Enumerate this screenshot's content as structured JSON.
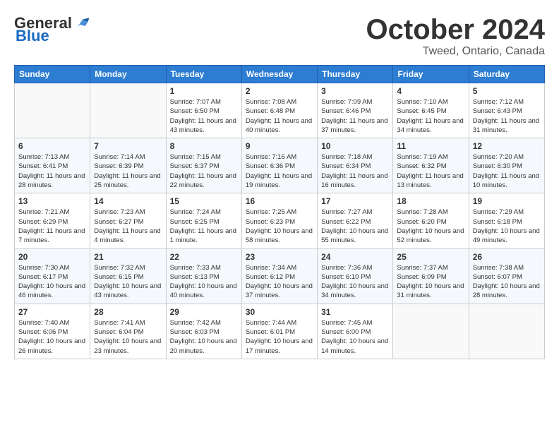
{
  "logo": {
    "general": "General",
    "blue": "Blue"
  },
  "title": "October 2024",
  "subtitle": "Tweed, Ontario, Canada",
  "weekdays": [
    "Sunday",
    "Monday",
    "Tuesday",
    "Wednesday",
    "Thursday",
    "Friday",
    "Saturday"
  ],
  "weeks": [
    [
      {
        "day": "",
        "sunrise": "",
        "sunset": "",
        "daylight": ""
      },
      {
        "day": "",
        "sunrise": "",
        "sunset": "",
        "daylight": ""
      },
      {
        "day": "1",
        "sunrise": "Sunrise: 7:07 AM",
        "sunset": "Sunset: 6:50 PM",
        "daylight": "Daylight: 11 hours and 43 minutes."
      },
      {
        "day": "2",
        "sunrise": "Sunrise: 7:08 AM",
        "sunset": "Sunset: 6:48 PM",
        "daylight": "Daylight: 11 hours and 40 minutes."
      },
      {
        "day": "3",
        "sunrise": "Sunrise: 7:09 AM",
        "sunset": "Sunset: 6:46 PM",
        "daylight": "Daylight: 11 hours and 37 minutes."
      },
      {
        "day": "4",
        "sunrise": "Sunrise: 7:10 AM",
        "sunset": "Sunset: 6:45 PM",
        "daylight": "Daylight: 11 hours and 34 minutes."
      },
      {
        "day": "5",
        "sunrise": "Sunrise: 7:12 AM",
        "sunset": "Sunset: 6:43 PM",
        "daylight": "Daylight: 11 hours and 31 minutes."
      }
    ],
    [
      {
        "day": "6",
        "sunrise": "Sunrise: 7:13 AM",
        "sunset": "Sunset: 6:41 PM",
        "daylight": "Daylight: 11 hours and 28 minutes."
      },
      {
        "day": "7",
        "sunrise": "Sunrise: 7:14 AM",
        "sunset": "Sunset: 6:39 PM",
        "daylight": "Daylight: 11 hours and 25 minutes."
      },
      {
        "day": "8",
        "sunrise": "Sunrise: 7:15 AM",
        "sunset": "Sunset: 6:37 PM",
        "daylight": "Daylight: 11 hours and 22 minutes."
      },
      {
        "day": "9",
        "sunrise": "Sunrise: 7:16 AM",
        "sunset": "Sunset: 6:36 PM",
        "daylight": "Daylight: 11 hours and 19 minutes."
      },
      {
        "day": "10",
        "sunrise": "Sunrise: 7:18 AM",
        "sunset": "Sunset: 6:34 PM",
        "daylight": "Daylight: 11 hours and 16 minutes."
      },
      {
        "day": "11",
        "sunrise": "Sunrise: 7:19 AM",
        "sunset": "Sunset: 6:32 PM",
        "daylight": "Daylight: 11 hours and 13 minutes."
      },
      {
        "day": "12",
        "sunrise": "Sunrise: 7:20 AM",
        "sunset": "Sunset: 6:30 PM",
        "daylight": "Daylight: 11 hours and 10 minutes."
      }
    ],
    [
      {
        "day": "13",
        "sunrise": "Sunrise: 7:21 AM",
        "sunset": "Sunset: 6:29 PM",
        "daylight": "Daylight: 11 hours and 7 minutes."
      },
      {
        "day": "14",
        "sunrise": "Sunrise: 7:23 AM",
        "sunset": "Sunset: 6:27 PM",
        "daylight": "Daylight: 11 hours and 4 minutes."
      },
      {
        "day": "15",
        "sunrise": "Sunrise: 7:24 AM",
        "sunset": "Sunset: 6:25 PM",
        "daylight": "Daylight: 11 hours and 1 minute."
      },
      {
        "day": "16",
        "sunrise": "Sunrise: 7:25 AM",
        "sunset": "Sunset: 6:23 PM",
        "daylight": "Daylight: 10 hours and 58 minutes."
      },
      {
        "day": "17",
        "sunrise": "Sunrise: 7:27 AM",
        "sunset": "Sunset: 6:22 PM",
        "daylight": "Daylight: 10 hours and 55 minutes."
      },
      {
        "day": "18",
        "sunrise": "Sunrise: 7:28 AM",
        "sunset": "Sunset: 6:20 PM",
        "daylight": "Daylight: 10 hours and 52 minutes."
      },
      {
        "day": "19",
        "sunrise": "Sunrise: 7:29 AM",
        "sunset": "Sunset: 6:18 PM",
        "daylight": "Daylight: 10 hours and 49 minutes."
      }
    ],
    [
      {
        "day": "20",
        "sunrise": "Sunrise: 7:30 AM",
        "sunset": "Sunset: 6:17 PM",
        "daylight": "Daylight: 10 hours and 46 minutes."
      },
      {
        "day": "21",
        "sunrise": "Sunrise: 7:32 AM",
        "sunset": "Sunset: 6:15 PM",
        "daylight": "Daylight: 10 hours and 43 minutes."
      },
      {
        "day": "22",
        "sunrise": "Sunrise: 7:33 AM",
        "sunset": "Sunset: 6:13 PM",
        "daylight": "Daylight: 10 hours and 40 minutes."
      },
      {
        "day": "23",
        "sunrise": "Sunrise: 7:34 AM",
        "sunset": "Sunset: 6:12 PM",
        "daylight": "Daylight: 10 hours and 37 minutes."
      },
      {
        "day": "24",
        "sunrise": "Sunrise: 7:36 AM",
        "sunset": "Sunset: 6:10 PM",
        "daylight": "Daylight: 10 hours and 34 minutes."
      },
      {
        "day": "25",
        "sunrise": "Sunrise: 7:37 AM",
        "sunset": "Sunset: 6:09 PM",
        "daylight": "Daylight: 10 hours and 31 minutes."
      },
      {
        "day": "26",
        "sunrise": "Sunrise: 7:38 AM",
        "sunset": "Sunset: 6:07 PM",
        "daylight": "Daylight: 10 hours and 28 minutes."
      }
    ],
    [
      {
        "day": "27",
        "sunrise": "Sunrise: 7:40 AM",
        "sunset": "Sunset: 6:06 PM",
        "daylight": "Daylight: 10 hours and 26 minutes."
      },
      {
        "day": "28",
        "sunrise": "Sunrise: 7:41 AM",
        "sunset": "Sunset: 6:04 PM",
        "daylight": "Daylight: 10 hours and 23 minutes."
      },
      {
        "day": "29",
        "sunrise": "Sunrise: 7:42 AM",
        "sunset": "Sunset: 6:03 PM",
        "daylight": "Daylight: 10 hours and 20 minutes."
      },
      {
        "day": "30",
        "sunrise": "Sunrise: 7:44 AM",
        "sunset": "Sunset: 6:01 PM",
        "daylight": "Daylight: 10 hours and 17 minutes."
      },
      {
        "day": "31",
        "sunrise": "Sunrise: 7:45 AM",
        "sunset": "Sunset: 6:00 PM",
        "daylight": "Daylight: 10 hours and 14 minutes."
      },
      {
        "day": "",
        "sunrise": "",
        "sunset": "",
        "daylight": ""
      },
      {
        "day": "",
        "sunrise": "",
        "sunset": "",
        "daylight": ""
      }
    ]
  ]
}
